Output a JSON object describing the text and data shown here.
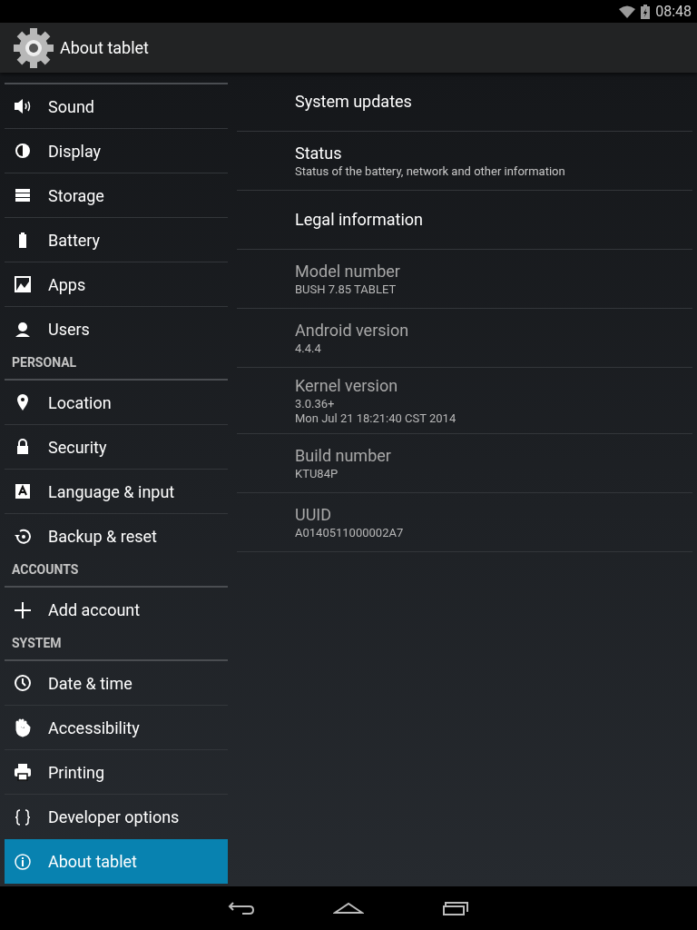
{
  "status_bar": {
    "time": "08:48"
  },
  "action_bar": {
    "title": "About tablet"
  },
  "sidebar": {
    "items": [
      {
        "kind": "divider"
      },
      {
        "kind": "item",
        "label": "Sound",
        "selected": false
      },
      {
        "kind": "item",
        "label": "Display",
        "selected": false
      },
      {
        "kind": "item",
        "label": "Storage",
        "selected": false
      },
      {
        "kind": "item",
        "label": "Battery",
        "selected": false
      },
      {
        "kind": "item",
        "label": "Apps",
        "selected": false
      },
      {
        "kind": "item",
        "label": "Users",
        "selected": false
      },
      {
        "kind": "header",
        "label": "PERSONAL"
      },
      {
        "kind": "item",
        "label": "Location",
        "selected": false
      },
      {
        "kind": "item",
        "label": "Security",
        "selected": false
      },
      {
        "kind": "item",
        "label": "Language & input",
        "selected": false
      },
      {
        "kind": "item",
        "label": "Backup & reset",
        "selected": false
      },
      {
        "kind": "header",
        "label": "ACCOUNTS"
      },
      {
        "kind": "item",
        "label": "Add account",
        "selected": false
      },
      {
        "kind": "header",
        "label": "SYSTEM"
      },
      {
        "kind": "item",
        "label": "Date & time",
        "selected": false
      },
      {
        "kind": "item",
        "label": "Accessibility",
        "selected": false
      },
      {
        "kind": "item",
        "label": "Printing",
        "selected": false
      },
      {
        "kind": "item",
        "label": "Developer options",
        "selected": false
      },
      {
        "kind": "item",
        "label": "About tablet",
        "selected": true
      }
    ]
  },
  "details": [
    {
      "title": "System updates",
      "disabled": false
    },
    {
      "title": "Status",
      "summary": "Status of the battery, network and other information",
      "disabled": false
    },
    {
      "title": "Legal information",
      "disabled": false
    },
    {
      "title": "Model number",
      "summary": "BUSH 7.85 TABLET",
      "disabled": true
    },
    {
      "title": "Android version",
      "summary": "4.4.4",
      "disabled": true
    },
    {
      "title": "Kernel version",
      "summary": "3.0.36+\nMon Jul 21 18:21:40 CST 2014",
      "disabled": true
    },
    {
      "title": "Build number",
      "summary": "KTU84P",
      "disabled": true
    },
    {
      "title": "UUID",
      "summary": "A0140511000002A7",
      "disabled": true
    }
  ]
}
